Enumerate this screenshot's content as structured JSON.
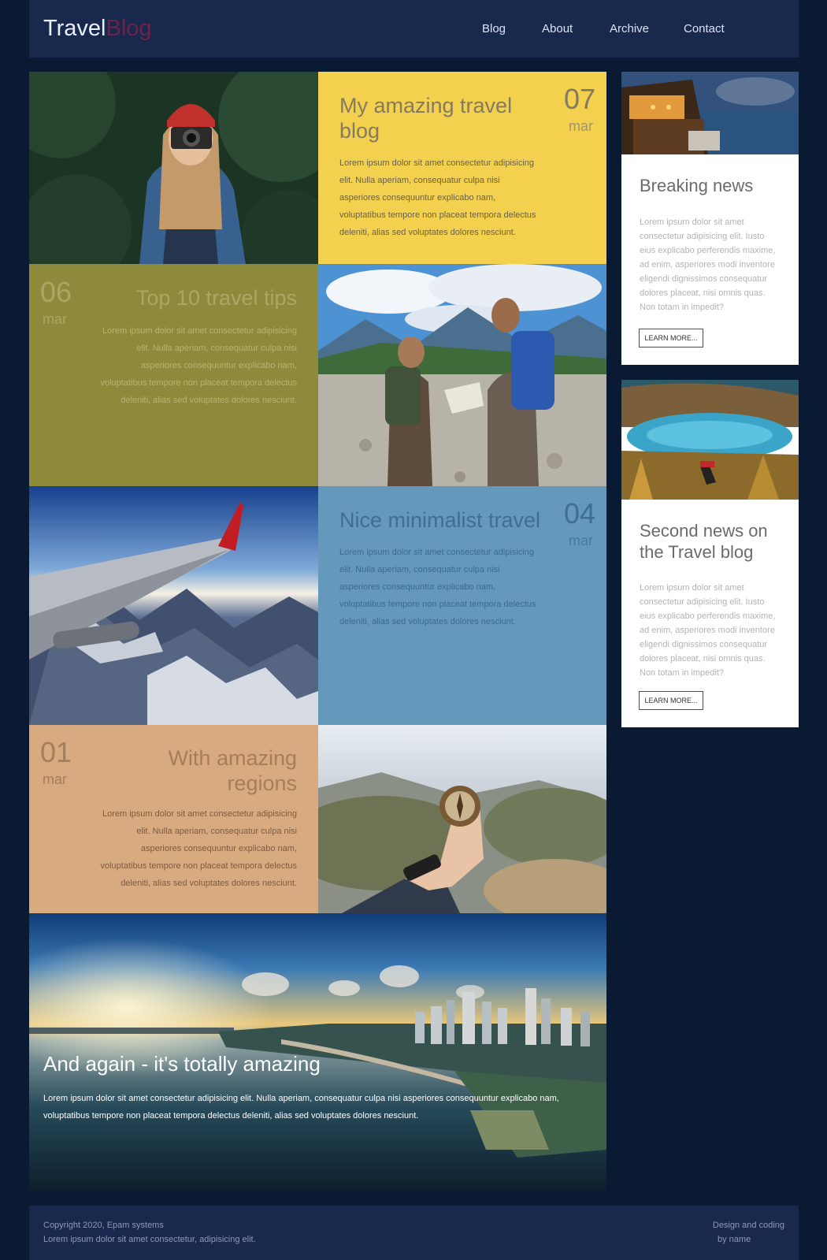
{
  "header": {
    "logo_part1": "Travel",
    "logo_part2": "Blog",
    "nav": [
      "Blog",
      "About",
      "Archive",
      "Contact"
    ]
  },
  "posts": [
    {
      "title": "My amazing travel blog",
      "day": "07",
      "month": "mar",
      "text": "Lorem ipsum dolor sit amet consectetur adipisicing elit. Nulla aperiam, consequatur culpa nisi asperiores consequuntur explicabo nam, voluptatibus tempore non placeat tempora delectus deleniti, alias sed voluptates dolores nesciunt.",
      "color": "#f3d04e"
    },
    {
      "title": "Top 10 travel tips",
      "day": "06",
      "month": "mar",
      "text": "Lorem ipsum dolor sit amet consectetur adipisicing elit. Nulla aperiam, consequatur culpa nisi asperiores consequuntur explicabo nam, voluptatibus tempore non placeat tempora delectus deleniti, alias sed voluptates dolores nesciunt.",
      "color": "#8d8a3c"
    },
    {
      "title": "Nice minimalist travel",
      "day": "04",
      "month": "mar",
      "text": "Lorem ipsum dolor sit amet consectetur adipisicing elit. Nulla aperiam, consequatur culpa nisi asperiores consequuntur explicabo nam, voluptatibus tempore non placeat tempora delectus deleniti, alias sed voluptates dolores nesciunt.",
      "color": "#6499bb"
    },
    {
      "title": "With amazing regions",
      "day": "01",
      "month": "mar",
      "text": "Lorem ipsum dolor sit amet consectetur adipisicing elit. Nulla aperiam, consequatur culpa nisi asperiores consequuntur explicabo nam, voluptatibus tempore non placeat tempora delectus deleniti, alias sed voluptates dolores nesciunt.",
      "color": "#d8aa80"
    }
  ],
  "feature": {
    "title": "And again - it's totally amazing",
    "text": "Lorem ipsum dolor sit amet consectetur adipisicing elit. Nulla aperiam, consequatur culpa nisi asperiores consequuntur explicabo nam, voluptatibus tempore non placeat tempora delectus deleniti, alias sed voluptates dolores nesciunt."
  },
  "sidebar": {
    "cards": [
      {
        "title": "Breaking news",
        "text": "Lorem ipsum dolor sit amet consectetur adipisicing elit. Iusto eius explicabo perferendis maxime, ad enim, asperiores modi inventore eligendi dignissimos consequatur dolores placeat, nisi omnis quas. Non totam in impedit?",
        "button": "LEARN MORE..."
      },
      {
        "title": "Second news on the Travel blog",
        "text": "Lorem ipsum dolor sit amet consectetur adipisicing elit. Iusto eius explicabo perferendis maxime, ad enim, asperiores modi inventore eligendi dignissimos consequatur dolores placeat, nisi omnis quas. Non totam in impedit?",
        "button": "LEARN MORE..."
      }
    ]
  },
  "footer": {
    "copyright": "Copyright 2020, Epam systems",
    "subline": "Lorem ipsum dolor sit amet consectetur, adipisicing elit.",
    "credit_line1": "Design and coding",
    "credit_line2": "by name"
  }
}
